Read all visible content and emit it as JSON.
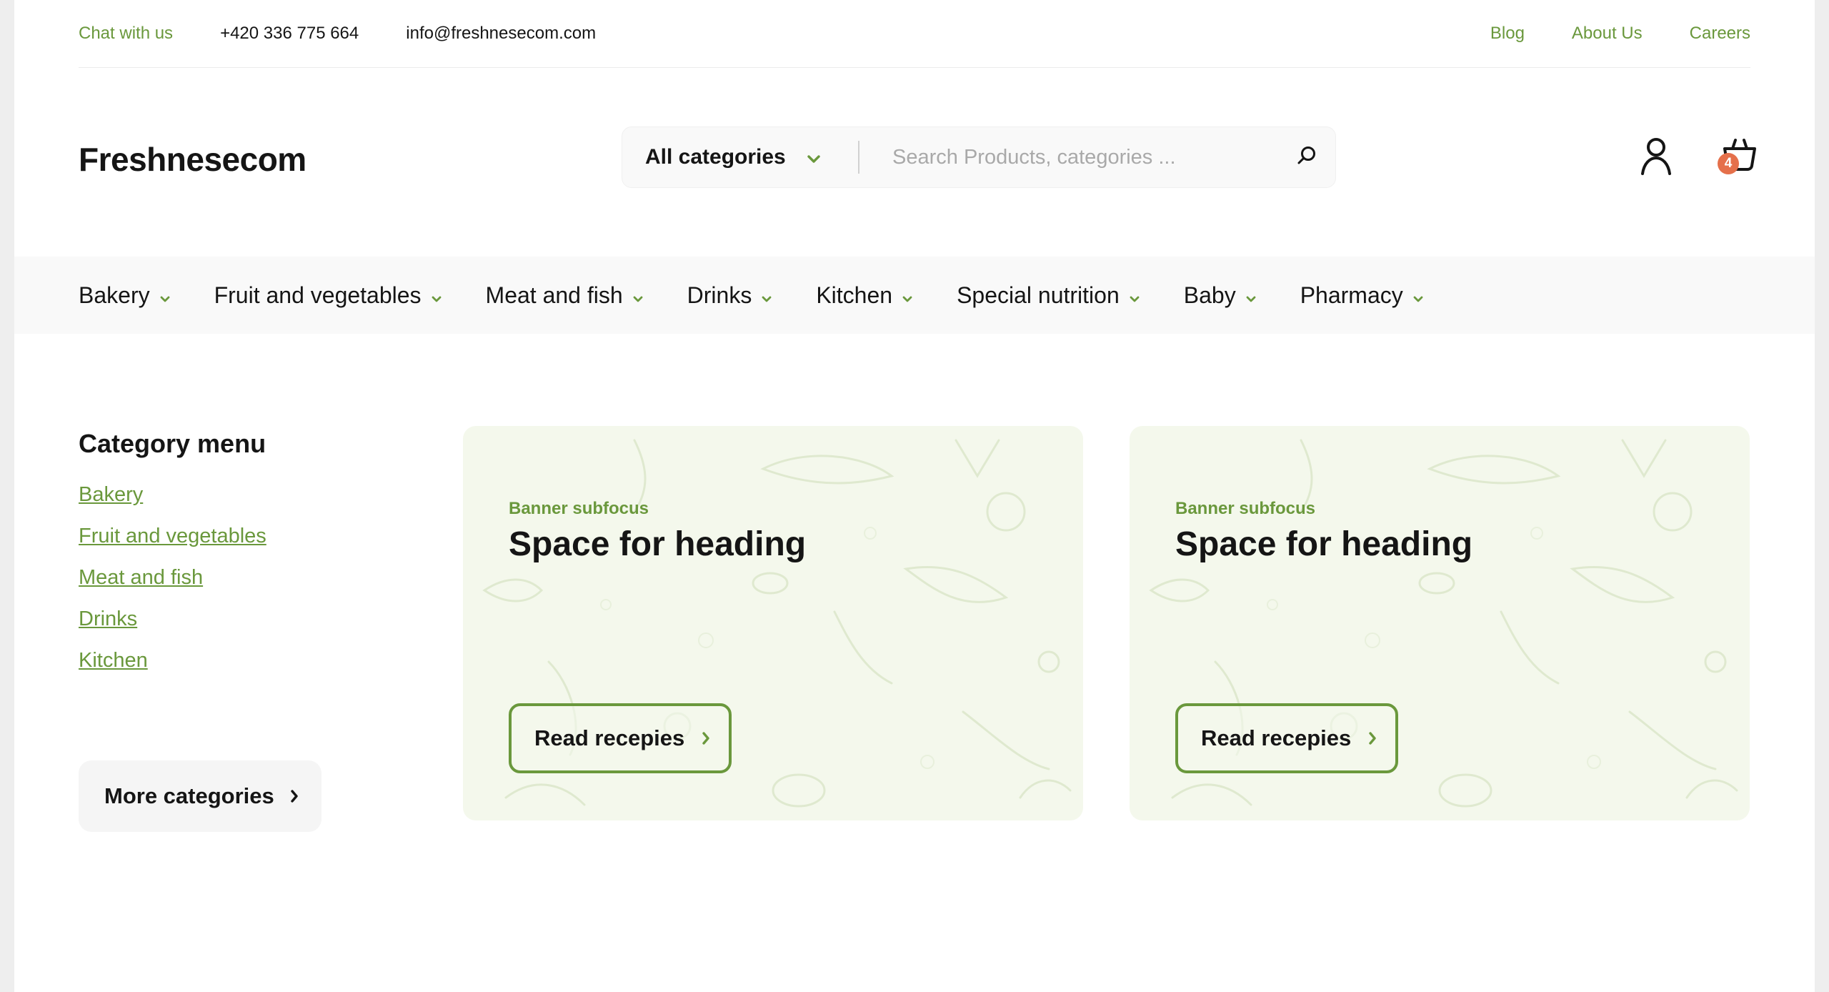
{
  "topbar": {
    "chat_label": "Chat with us",
    "phone": "+420 336 775 664",
    "email": "info@freshnesecom.com",
    "links": [
      "Blog",
      "About Us",
      "Careers"
    ]
  },
  "header": {
    "logo": "Freshnesecom",
    "search": {
      "category_label": "All categories",
      "placeholder": "Search Products, categories ..."
    },
    "cart_count": "4"
  },
  "nav": {
    "items": [
      "Bakery",
      "Fruit and vegetables",
      "Meat and fish",
      "Drinks",
      "Kitchen",
      "Special nutrition",
      "Baby",
      "Pharmacy"
    ]
  },
  "sidebar": {
    "title": "Category menu",
    "links": [
      "Bakery",
      "Fruit and vegetables",
      "Meat and fish",
      "Drinks",
      "Kitchen"
    ],
    "more_label": "More categories"
  },
  "banners": [
    {
      "subfocus": "Banner subfocus",
      "heading": "Space for heading",
      "button": "Read recepies"
    },
    {
      "subfocus": "Banner subfocus",
      "heading": "Space for heading",
      "button": "Read recepies"
    }
  ],
  "colors": {
    "accent_green": "#6a983c",
    "badge_orange": "#e5704b",
    "banner_bg": "#f4f8ec",
    "text_dark": "#151515"
  },
  "icons": {
    "search": "search-icon",
    "user": "user-icon",
    "cart": "basket-icon",
    "chevron": "chevron-down-icon",
    "arrow": "chevron-right-icon"
  }
}
